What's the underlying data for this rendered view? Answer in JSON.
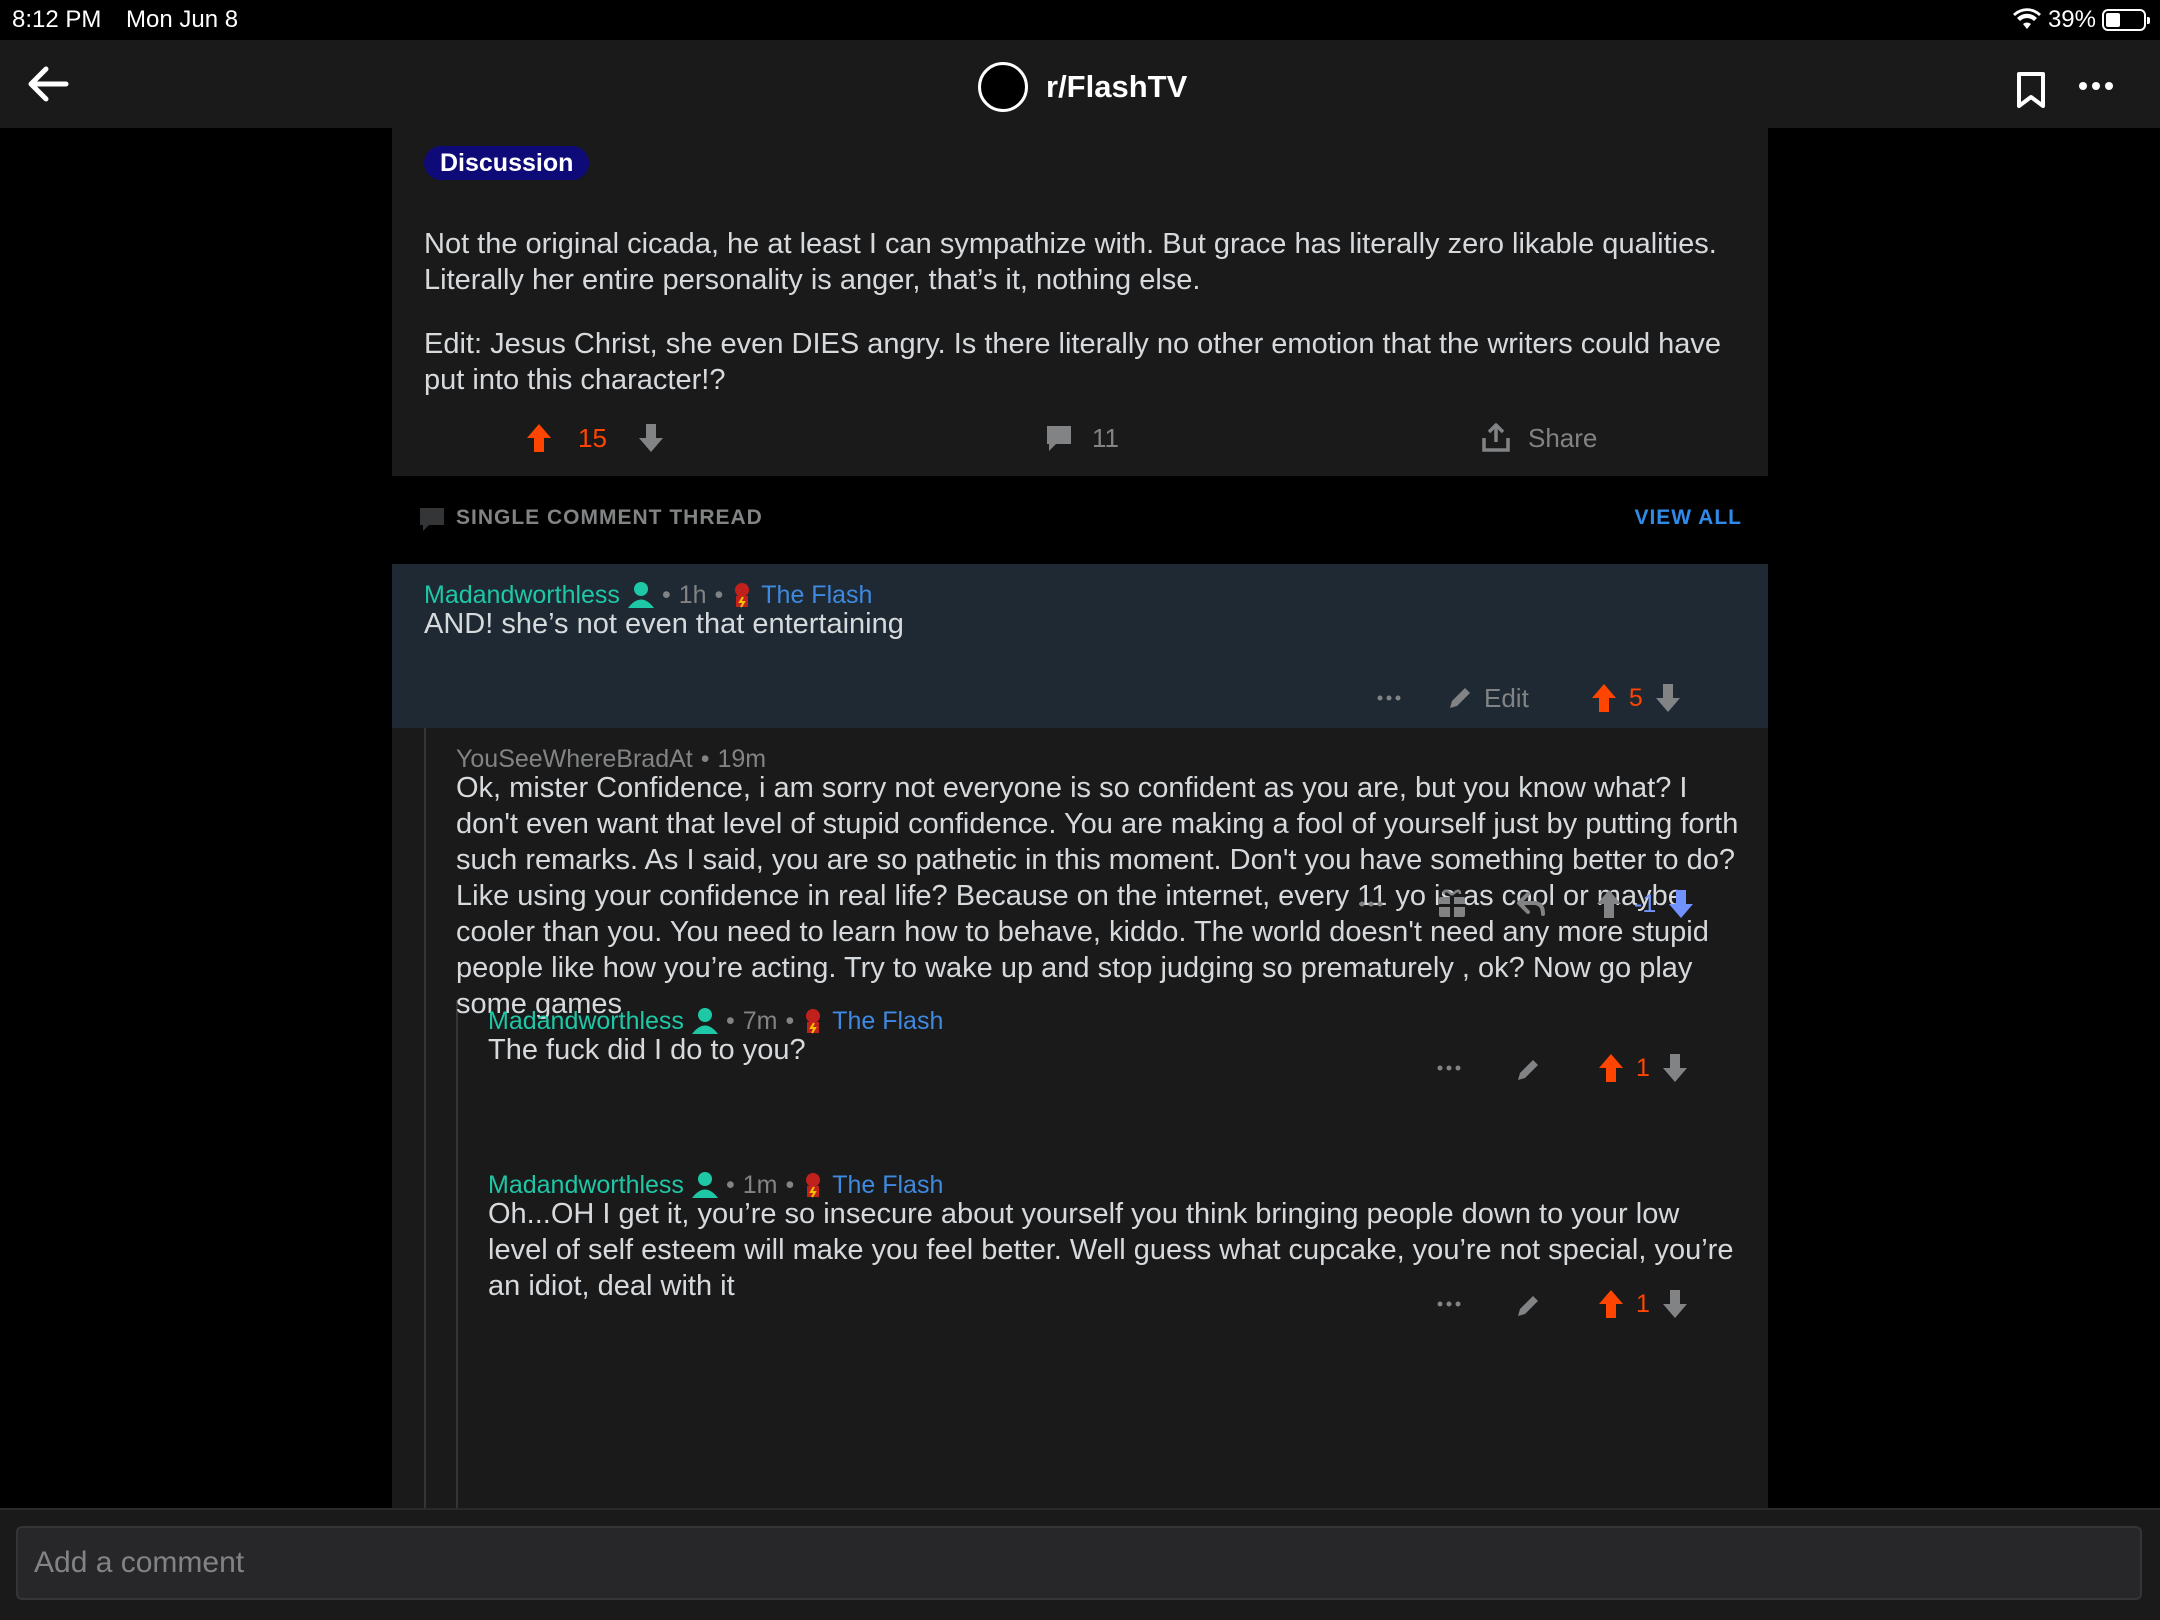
{
  "status_bar": {
    "time": "8:12 PM",
    "date": "Mon Jun 8",
    "battery": "39%"
  },
  "nav": {
    "title": "r/FlashTV"
  },
  "post": {
    "flair": "Discussion",
    "paragraphs": [
      "Not the original cicada, he at least I can sympathize with. But grace has literally zero likable qualities. Literally her entire personality is anger, that’s it, nothing else.",
      "Edit: Jesus Christ,  she even DIES angry. Is there literally no other emotion that the writers could have put into this character!?"
    ],
    "score": "15",
    "comments": "11",
    "share": "Share"
  },
  "thread": {
    "label": "SINGLE COMMENT THREAD",
    "view_all": "VIEW ALL"
  },
  "comments": [
    {
      "user": "Madandworthless",
      "time": "1h",
      "flair": "The Flash",
      "sep": "•",
      "text": "AND! she’s not even that entertaining",
      "edit": "Edit",
      "score": "5"
    },
    {
      "user": "YouSeeWhereBradAt",
      "time": "19m",
      "sep": "•",
      "text": "Ok, mister Confidence, i am sorry not everyone is so confident as you are, but you know what? I don't even want that level of stupid confidence. You are making a fool of yourself just by putting forth such remarks. As I said, you are so pathetic in this moment. Don't you have something better to do? Like using your confidence in real life? Because on the internet, every 11 yo is as cool or maybe cooler than you. You need to learn how to behave, kiddo. The world doesn't need any more stupid people like how you’re acting. Try to wake up and stop judging so prematurely , ok? Now go play some games",
      "score": "-1"
    },
    {
      "user": "Madandworthless",
      "time": "7m",
      "flair": "The Flash",
      "sep": "•",
      "text": "The fuck did I do to you?",
      "score": "1"
    },
    {
      "user": "Madandworthless",
      "time": "1m",
      "flair": "The Flash",
      "sep": "•",
      "text": "Oh...OH I get it, you’re so insecure about yourself you think bringing people down to your low level of self esteem will make you feel better. Well guess what cupcake, you’re not special, you’re an idiot, deal with it",
      "score": "1"
    }
  ],
  "composer": {
    "placeholder": "Add a comment"
  },
  "colors": {
    "upvote": "#ff4500",
    "downvote": "#7193ff",
    "username": "#1ec8a7",
    "flair_link": "#3f8ae0",
    "flair_bg": "#0e0a77"
  }
}
